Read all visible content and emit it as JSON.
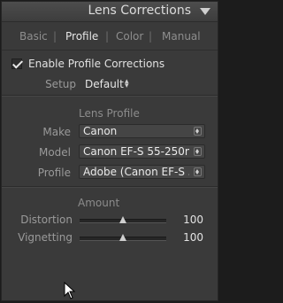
{
  "panel": {
    "title": "Lens Corrections",
    "tabs": [
      {
        "label": "Basic",
        "active": false
      },
      {
        "label": "Profile",
        "active": true
      },
      {
        "label": "Color",
        "active": false
      },
      {
        "label": "Manual",
        "active": false
      }
    ],
    "tab_separator": "|"
  },
  "enable": {
    "label": "Enable Profile Corrections",
    "checked": true
  },
  "setup": {
    "label": "Setup",
    "value": "Default",
    "updown_icon": "updown-arrows-icon"
  },
  "lens_profile": {
    "title": "Lens Profile",
    "make": {
      "label": "Make",
      "value": "Canon"
    },
    "model": {
      "label": "Model",
      "value": "Canon EF-S 55-250m..."
    },
    "profile": {
      "label": "Profile",
      "value": "Adobe (Canon EF-S 5..."
    }
  },
  "amount": {
    "title": "Amount",
    "distortion": {
      "label": "Distortion",
      "value": "100",
      "level": 0.5
    },
    "vignetting": {
      "label": "Vignetting",
      "value": "100",
      "level": 0.5
    }
  },
  "colors": {
    "panel_bg": "#3a3a3a",
    "text_active": "#e6e6e6",
    "text_muted": "#8e8e8e"
  }
}
